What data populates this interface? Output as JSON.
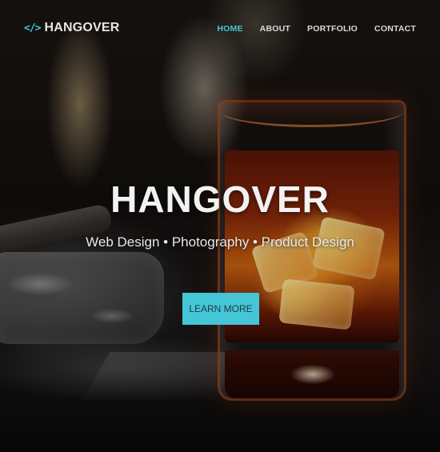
{
  "brand": {
    "icon": "code-brackets-icon",
    "icon_glyph": "</>",
    "name": "HANGOVER"
  },
  "nav": {
    "items": [
      {
        "label": "HOME",
        "active": true
      },
      {
        "label": "ABOUT",
        "active": false
      },
      {
        "label": "PORTFOLIO",
        "active": false
      },
      {
        "label": "CONTACT",
        "active": false
      }
    ]
  },
  "hero": {
    "title": "HANGOVER",
    "subtitle": "Web Design • Photography • Product Design",
    "cta_label": "LEARN MORE"
  },
  "colors": {
    "accent": "#45c6d6",
    "nav_text": "#d9d9d9"
  }
}
